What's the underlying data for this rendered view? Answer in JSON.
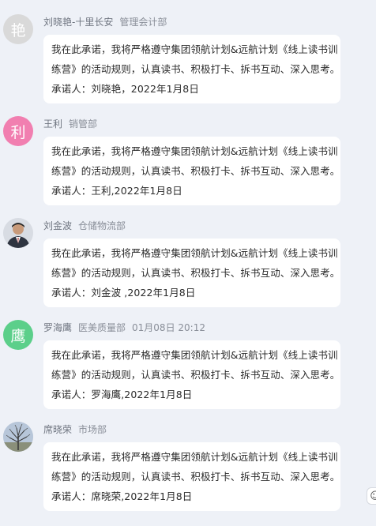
{
  "messages": [
    {
      "avatar_char": "艳",
      "avatar_color": "#d9d9d9",
      "name": "刘晓艳-十里长安",
      "dept": "管理会计部",
      "time": "",
      "lines": [
        "我在此承诺，我将严格遵守集团领航计划&远航计划《线上读书训",
        "练营》的活动规则，认真读书、积极打卡、拆书互动、深入思考。",
        "承诺人：刘晓艳，2022年1月8日"
      ]
    },
    {
      "avatar_char": "利",
      "avatar_color": "#f17fb0",
      "name": "王利",
      "dept": "销管部",
      "time": "",
      "lines": [
        "我在此承诺，我将严格遵守集团领航计划&远航计划《线上读书训",
        "练营》的活动规则，认真读书、积极打卡、拆书互动、深入思考。",
        "承诺人：王利,2022年1月8日"
      ]
    },
    {
      "avatar_char": "",
      "avatar_color": "#5a6270",
      "name": "刘金波",
      "dept": "仓储物流部",
      "time": "",
      "lines": [
        "我在此承诺，我将严格遵守集团领航计划&远航计划《线上读书训",
        "练营》的活动规则，认真读书、积极打卡、拆书互动、深入思考。",
        "承诺人：刘金波 ,2022年1月8日"
      ]
    },
    {
      "avatar_char": "鹰",
      "avatar_color": "#5ccf8a",
      "name": "罗海鹰",
      "dept": "医美质量部",
      "time": "01月08日 20:12",
      "lines": [
        "我在此承诺，我将严格遵守集团领航计划&远航计划《线上读书训",
        "练营》的活动规则，认真读书、积极打卡、拆书互动、深入思考。",
        "承诺人：罗海鹰,2022年1月8日"
      ]
    },
    {
      "avatar_char": "",
      "avatar_color": "#7f8fa6",
      "name": "席晓荣",
      "dept": "市场部",
      "time": "",
      "lines": [
        "我在此承诺，我将严格遵守集团领航计划&远航计划《线上读书训",
        "练营》的活动规则，认真读书、积极打卡、拆书互动、深入思考。",
        "承诺人：席晓荣,2022年1月8日"
      ]
    }
  ],
  "fab": {
    "icon": "smiley-icon"
  }
}
